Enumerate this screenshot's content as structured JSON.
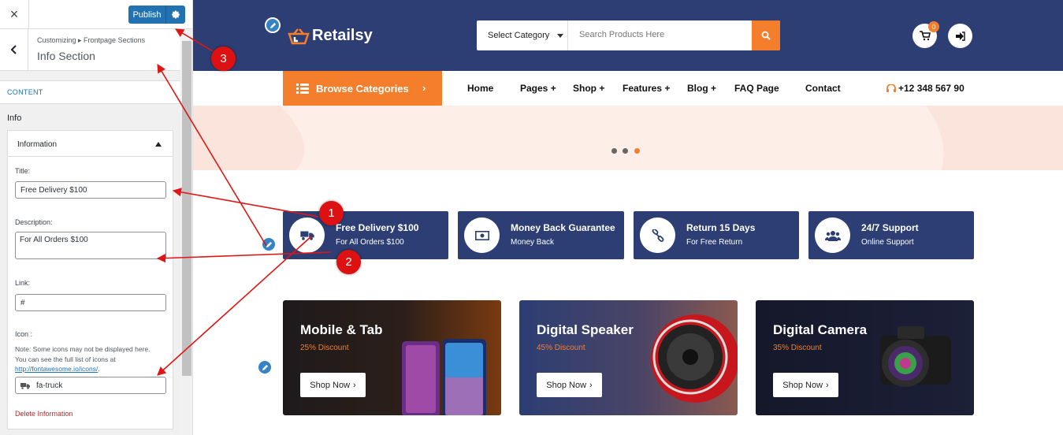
{
  "customizer": {
    "close_icon": "×",
    "publish_label": "Publish",
    "breadcrumb": "Customizing ▸ Frontpage Sections",
    "section_title": "Info Section",
    "content_label": "CONTENT",
    "info_label": "Info",
    "panel_title": "Information",
    "title_label": "Title:",
    "title_value": "Free Delivery $100",
    "description_label": "Description:",
    "description_value": "For All Orders $100",
    "link_label": "Link:",
    "link_value": "#",
    "icon_label": "Icon :",
    "note_line1": "Note: Some icons may not be displayed here.",
    "note_line2": "You can see the full list of icons at",
    "note_link": "http://fontawesome.io/icons/",
    "note_end": ".",
    "icon_value": "fa-truck",
    "delete_label": "Delete Information"
  },
  "site": {
    "logo_text": "Retailsy",
    "category_select": "Select Category",
    "search_placeholder": "Search Products Here",
    "cart_count": "0",
    "browse_label": "Browse Categories",
    "nav": [
      "Home",
      "Pages +",
      "Shop +",
      "Features +",
      "Blog +",
      "FAQ Page",
      "Contact"
    ],
    "phone": "+12 348 567 90",
    "features": [
      {
        "title": "Free Delivery $100",
        "subtitle": "For All Orders $100",
        "icon": "truck-icon"
      },
      {
        "title": "Money Back Guarantee",
        "subtitle": "Money Back",
        "icon": "money-icon"
      },
      {
        "title": "Return 15 Days",
        "subtitle": "For Free Return",
        "icon": "link-icon"
      },
      {
        "title": "24/7 Support",
        "subtitle": "Online Support",
        "icon": "users-icon"
      }
    ],
    "promos": [
      {
        "title": "Mobile & Tab",
        "discount": "25% Discount",
        "button": "Shop Now"
      },
      {
        "title": "Digital Speaker",
        "discount": "45% Discount",
        "button": "Shop Now"
      },
      {
        "title": "Digital Camera",
        "discount": "35% Discount",
        "button": "Shop Now"
      }
    ]
  },
  "annotations": [
    "1",
    "2",
    "3"
  ],
  "colors": {
    "navy": "#2c3e73",
    "orange": "#f47e2b",
    "wp_blue": "#2271b1",
    "annotation_red": "#dd1111"
  }
}
